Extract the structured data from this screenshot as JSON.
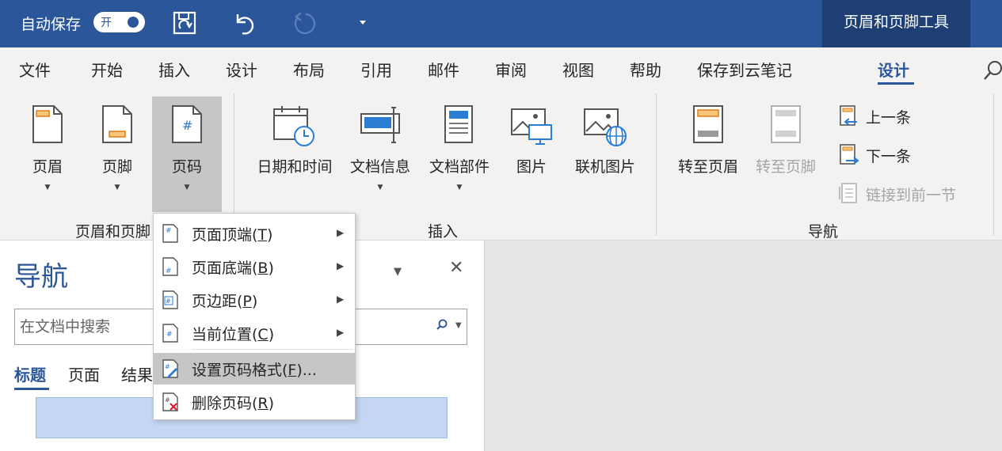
{
  "titlebar": {
    "autosave_label": "自动保存",
    "autosave_state": "开",
    "contextual_tab": "页眉和页脚工具",
    "accent_color": "#2b579a"
  },
  "tabs": [
    "文件",
    "开始",
    "插入",
    "设计",
    "布局",
    "引用",
    "邮件",
    "审阅",
    "视图",
    "帮助",
    "保存到云笔记",
    "设计"
  ],
  "active_tab": "设计",
  "ribbon": {
    "header_footer_group": {
      "label": "页眉和页脚",
      "buttons": [
        "页眉",
        "页脚",
        "页码"
      ]
    },
    "insert_group": {
      "label": "插入",
      "buttons": [
        "日期和时间",
        "文档信息",
        "文档部件",
        "图片",
        "联机图片"
      ]
    },
    "navigation_group": {
      "label": "导航",
      "goto_header": "转至页眉",
      "goto_footer": "转至页脚",
      "previous": "上一条",
      "next": "下一条",
      "link_previous": "链接到前一节"
    }
  },
  "page_number_menu": {
    "items": [
      {
        "text": "页面顶端(",
        "key": "T",
        "suffix": ")",
        "submenu": true
      },
      {
        "text": "页面底端(",
        "key": "B",
        "suffix": ")",
        "submenu": true
      },
      {
        "text": "页边距(",
        "key": "P",
        "suffix": ")",
        "submenu": true
      },
      {
        "text": "当前位置(",
        "key": "C",
        "suffix": ")",
        "submenu": true
      },
      {
        "text": "设置页码格式(",
        "key": "F",
        "suffix": ")...",
        "submenu": false
      },
      {
        "text": "删除页码(",
        "key": "R",
        "suffix": ")",
        "submenu": false
      }
    ],
    "submenu_arrow": "▶"
  },
  "nav_pane": {
    "title": "导航",
    "search_placeholder": "在文档中搜索",
    "tabs": [
      "标题",
      "页面",
      "结果"
    ],
    "close_glyph": "✕",
    "dropdown_glyph": "▼"
  },
  "glyphs": {
    "caret": "▼"
  }
}
